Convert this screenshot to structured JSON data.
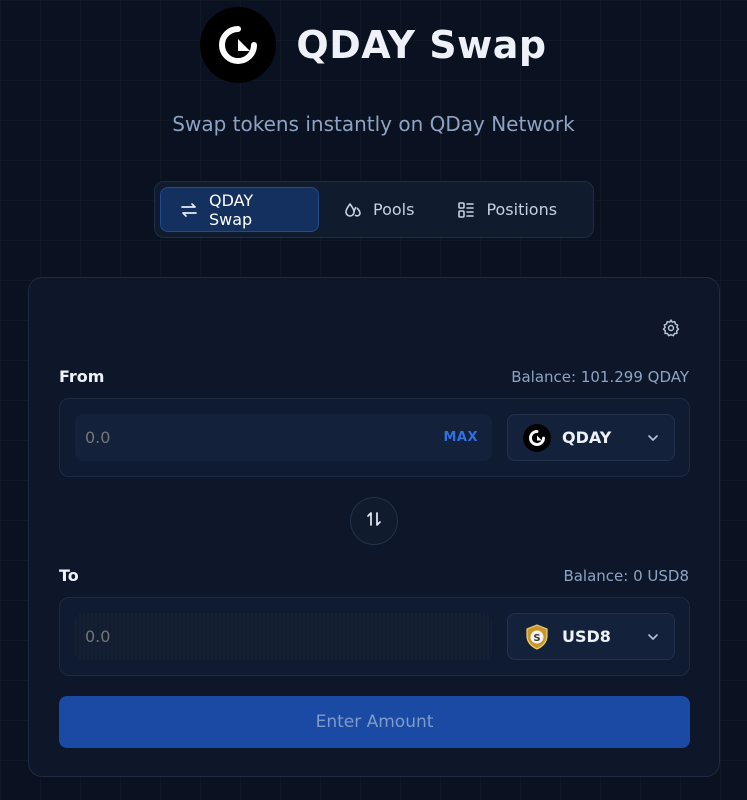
{
  "header": {
    "title": "QDAY Swap",
    "subtitle": "Swap tokens instantly on QDay Network",
    "logo_icon": "qday-logo-icon"
  },
  "tabs": [
    {
      "label": "QDAY Swap",
      "icon": "swap-arrows-icon",
      "active": true
    },
    {
      "label": "Pools",
      "icon": "droplets-icon",
      "active": false
    },
    {
      "label": "Positions",
      "icon": "list-layout-icon",
      "active": false
    }
  ],
  "swap": {
    "settings_icon": "gear-icon",
    "from": {
      "label": "From",
      "balance": "Balance: 101.299 QDAY",
      "amount_placeholder": "0.0",
      "max_label": "MAX",
      "token": "QDAY",
      "token_icon": "qday-token-icon"
    },
    "switch_icon": "swap-vertical-icon",
    "to": {
      "label": "To",
      "balance": "Balance: 0 USD8",
      "amount_placeholder": "0.0",
      "token": "USD8",
      "token_icon": "usd8-shield-icon"
    },
    "submit_label": "Enter Amount"
  },
  "colors": {
    "background": "#0a1120",
    "card": "#0d1729",
    "accent": "#1a4aa3",
    "max": "#2f6fe0",
    "muted_text": "#8ea3c4"
  }
}
